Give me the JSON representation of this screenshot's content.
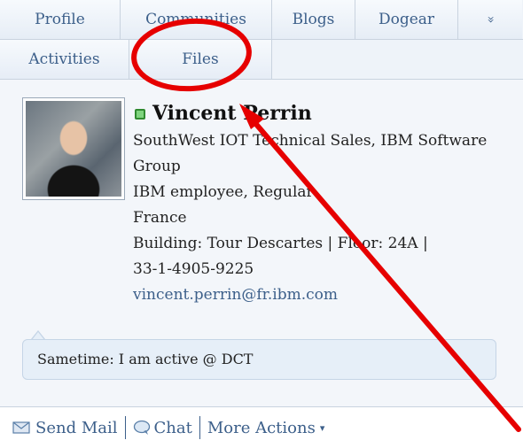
{
  "tabs": {
    "row1": [
      "Profile",
      "Communities",
      "Blogs",
      "Dogear"
    ],
    "more_icon": "double-chevron-down-icon",
    "more_glyph": "»",
    "row2": [
      "Activities",
      "Files"
    ]
  },
  "profile": {
    "status_icon": "online-status-icon",
    "name": "Vincent Perrin",
    "title_line1": "SouthWest IOT Technical Sales, IBM Software",
    "title_line2": "Group",
    "employee_type": "IBM employee, Regular",
    "country": "France",
    "building": "Building: Tour Descartes | Floor: 24A |",
    "phone": "33-1-4905-9225",
    "email": "vincent.perrin@fr.ibm.com",
    "photo_icon": "profile-photo"
  },
  "status_message": "Sametime: I am active @ DCT",
  "actions": {
    "send_mail": "Send Mail",
    "chat": "Chat",
    "more": "More Actions",
    "more_caret": "▾"
  },
  "annotations": {
    "circle_color": "#e60000",
    "arrow_color": "#e60000"
  }
}
